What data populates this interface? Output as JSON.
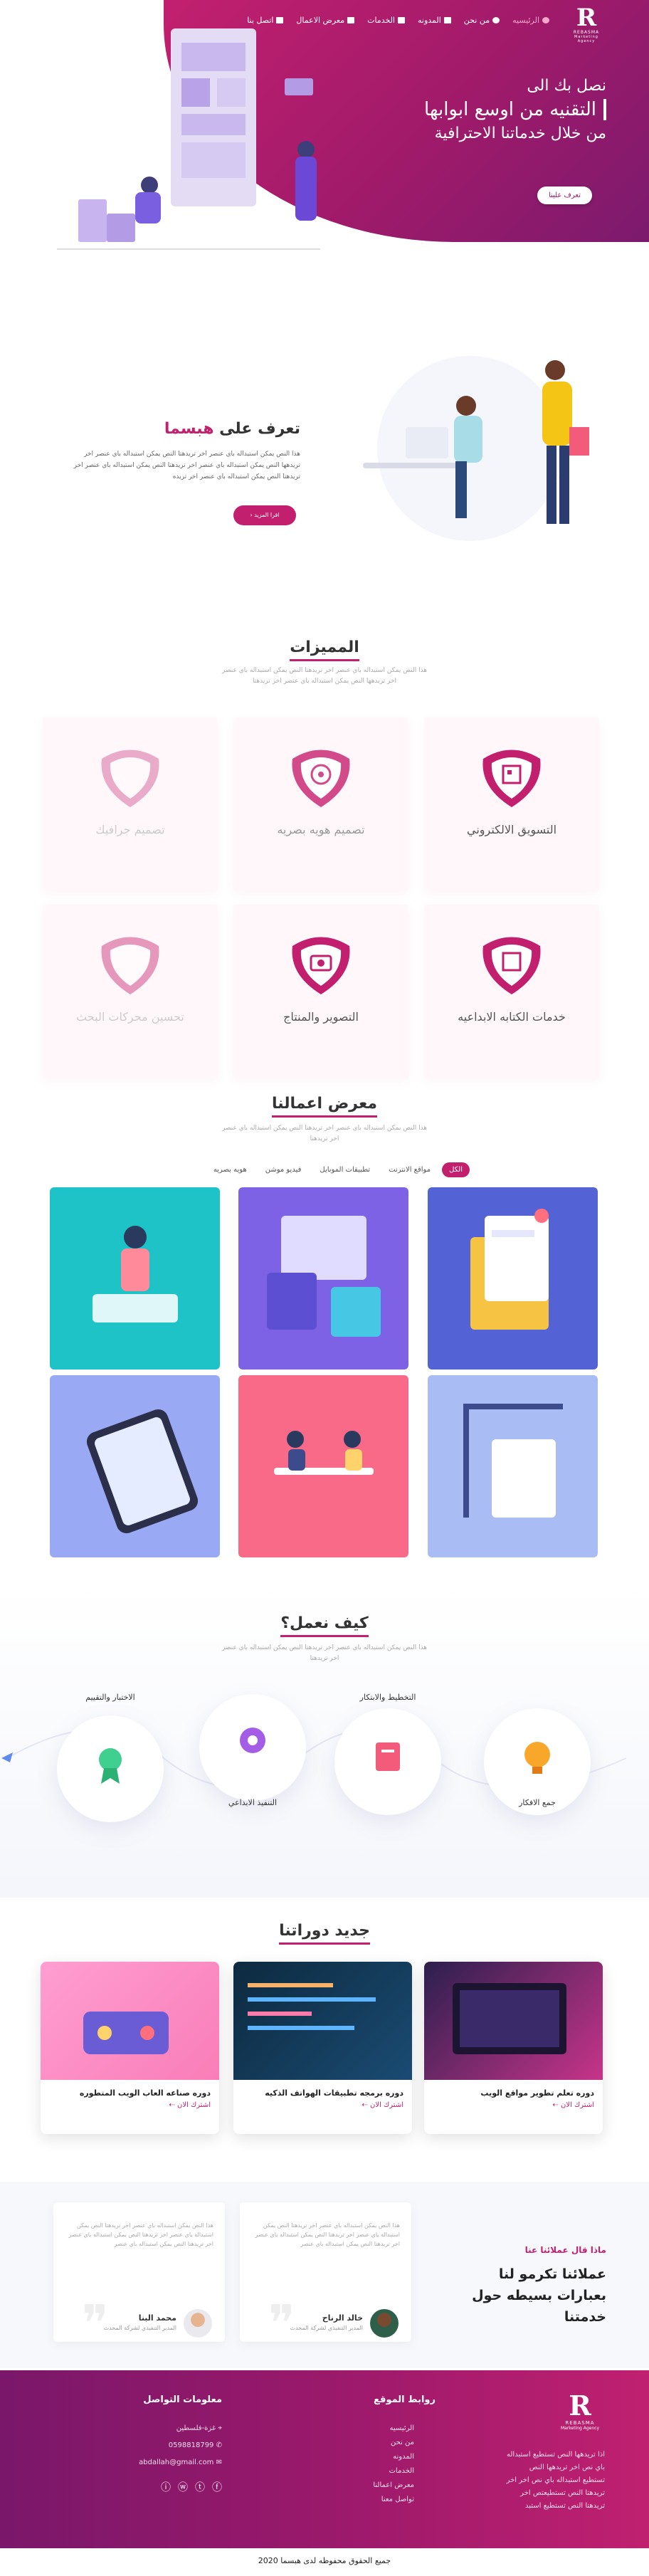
{
  "brand": {
    "mark": "R",
    "name": "REBASMA",
    "tagline": "Marketing Agency"
  },
  "nav": {
    "items": [
      {
        "label": "الرئيسيه",
        "icon": "home-icon",
        "active": true
      },
      {
        "label": "من نحن",
        "icon": "users-icon"
      },
      {
        "label": "المدونه",
        "icon": "book-icon"
      },
      {
        "label": "الخدمات",
        "icon": "monitor-icon"
      },
      {
        "label": "معرض الاعمال",
        "icon": "gallery-icon"
      },
      {
        "label": "اتصل بنا",
        "icon": "mail-icon"
      }
    ]
  },
  "hero": {
    "line1": "نصل بك الى",
    "line2": "التقنيه من اوسع ابوابها",
    "line3": "من خلال خدماتنا الاحترافية",
    "button": "تعرف علينا"
  },
  "about": {
    "title_prefix": "تعرف على",
    "title_brand": "هبسما",
    "text": "هذا النص يمكن استبداله باي عنصر اخر تريدهتا النص يمكن استبداله باي عنصر اخر تريدهها النص يمكن استبداله باي عنصر اخر تريدهتا النص يمكن استبداله باي عنصر اخر تريدهتا النص يمكن استبداله باي عنصر اخر تريده",
    "button": "اقرا المزيد ‹"
  },
  "features": {
    "title": "المميزات",
    "subtitle": "هذا النص يمكن استبداله باي عنصر اخر تريدهتا النص يمكن استبداله باي عنصر اخر تريدهها النص يمكن استبداله باي عنصر اخر تريدهتا",
    "items": [
      {
        "label": "التسويق الالكتروني",
        "icon": "qr-icon",
        "faded": false
      },
      {
        "label": "تصميم هويه بصريه",
        "icon": "target-icon",
        "faded": true
      },
      {
        "label": "تصميم جرافيك",
        "icon": "design-icon",
        "faded": true
      },
      {
        "label": "خدمات الكتابه الابداعيه",
        "icon": "qr-icon",
        "faded": false
      },
      {
        "label": "التصوير والمنتاج",
        "icon": "camera-icon",
        "faded": false
      },
      {
        "label": "تحسين محركات البحث",
        "icon": "search-icon",
        "faded": true
      }
    ]
  },
  "portfolio": {
    "title": "معرض اعمالنا",
    "subtitle": "هذا النص يمكن استبداله باي عنصر اخر تريدهتا النص يمكن استبداله باي عنصر اخر تريدهتا",
    "tabs": [
      "الكل",
      "مواقع الانترنت",
      "تطبيقات الموبايل",
      "فيديو موشن",
      "هويه بصريه"
    ],
    "items": [
      {
        "color": "#5363d6"
      },
      {
        "color": "#7e62e6"
      },
      {
        "color": "#1ec3c7"
      },
      {
        "color": "#a9bdf4"
      },
      {
        "color": "#f86a87"
      },
      {
        "color": "#9aa9f4"
      }
    ]
  },
  "how": {
    "title": "كيف نعمل؟",
    "subtitle": "هذا النص يمكن استبداله باي عنصر اخر تريدهتا النص يمكن استبداله باي عنصر اخر تريدهتا",
    "steps": [
      {
        "label": "جمع الافكار",
        "icon": "bulb-icon"
      },
      {
        "label": "التخطيط والابتكار",
        "icon": "planning-icon"
      },
      {
        "label": "التنفيذ الابداعي",
        "icon": "gear-icon"
      },
      {
        "label": "الاختبار والتقييم",
        "icon": "award-icon"
      }
    ]
  },
  "courses": {
    "title": "جديد دوراتنا",
    "link": "اشترك الان",
    "items": [
      {
        "title": "دوره تعلم تطوير مواقع الويب"
      },
      {
        "title": "دوره برمجه تطبيقات الهواتف الذكيه"
      },
      {
        "title": "دوره صناعه العاب الويب المتطوره"
      }
    ]
  },
  "testimonials": {
    "heading_small": "ماذا قال عملائنا عنا",
    "heading_big": "عملائنا تكرمو لنا بعبارات بسيطه حول خدمتنا",
    "items": [
      {
        "name": "خالد الرناح",
        "role": "المدير التنفيذي لشركة المحدث",
        "text": "هذا النص يمكن استبداله باي عنصر اخر تريدهتا النص يمكن استبداله باي عنصر اخر تريدهتا النص يمكن استبداله باي عنصر اخر تريدهتا النص يمكن استبداله باي عنصر"
      },
      {
        "name": "محمد البنا",
        "role": "المدير التنفيذي لشركة المحدث",
        "text": "هذا النص يمكن استبداله باي عنصر اخر تريدهتا النص يمكن استبداله باي عنصر اخر تريدهتا النص يمكن استبداله باي عنصر اخر تريدهتا النص يمكن استبداله باي عنصر"
      }
    ]
  },
  "footer": {
    "about_text": "اذا تريدهها النص تستطيع استبداله باي نص اخر تريدهها النص تستطيع استبداله باي نص اخر اخر تريدهتا النص تستطيعتص اخر تريدهتا النص تستطيع استبد",
    "links_title": "روابط الموقع",
    "links": [
      "الرئيسيه",
      "من نحن",
      "المدونه",
      "الخدمات",
      "معرض اعمالنا",
      "تواصل معنا"
    ],
    "contact_title": "معلومات التواصل",
    "address": "غزة-فلسطين",
    "phone": "0598818799",
    "email": "abdallah@gmail.com",
    "copyright": "جميع الحقوق محفوظه لدى هبسما 2020"
  }
}
